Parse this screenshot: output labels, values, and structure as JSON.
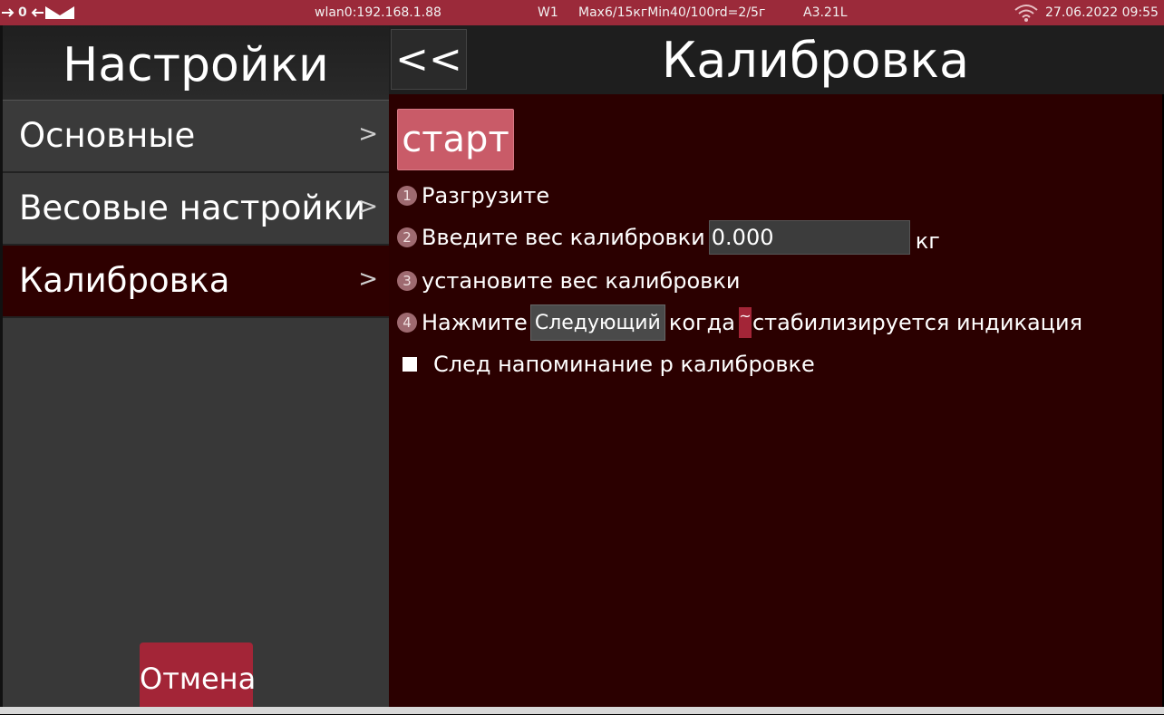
{
  "status_bar": {
    "port_value": "0",
    "wlan": "wlan0:192.168.1.88",
    "mode": "W1",
    "range": "Max6/15кгMin40/100rd=2/5г",
    "version": "A3.21L",
    "datetime": "27.06.2022 09:55"
  },
  "sidebar": {
    "title": "Настройки",
    "items": [
      {
        "label": "Основные"
      },
      {
        "label": "Весовые настройки"
      },
      {
        "label": "Калибровка"
      }
    ],
    "chevron": ">",
    "cancel_label": "Отмена"
  },
  "main": {
    "back_label": "<<",
    "title": "Калибровка",
    "start_label": "старт",
    "steps": [
      {
        "num": "1",
        "text": "Разгрузите"
      },
      {
        "num": "2",
        "text": "Введите вес калибровки",
        "input_value": "0.000",
        "unit": "кг"
      },
      {
        "num": "3",
        "text": "установите вес калибровки"
      },
      {
        "num": "4",
        "text_before": "Нажмите",
        "button_label": "Следующий",
        "text_middle": "когда",
        "stable_mark": "~",
        "text_after": "стабилизируется индикация"
      }
    ],
    "reminder_label": "След напоминание р калибровке"
  },
  "colors": {
    "status_bar": "#9b2a3a",
    "content_bg": "#2b0000",
    "sidebar_bg": "#383838",
    "accent_button": "#a32537",
    "start_button": "#c95b68"
  }
}
